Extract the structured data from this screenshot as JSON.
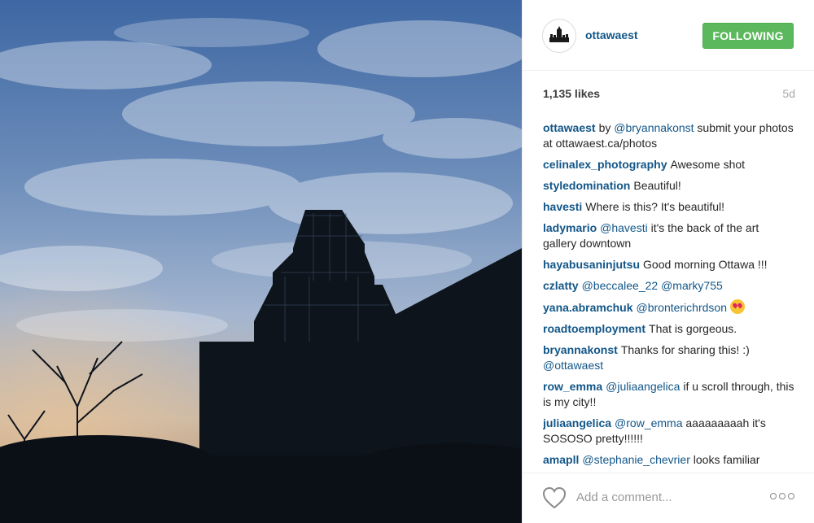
{
  "post": {
    "username": "ottawaest",
    "follow_label": "FOLLOWING",
    "likes": "1,135 likes",
    "age": "5d",
    "comments": [
      {
        "author": "ottawaest",
        "parts": [
          {
            "text": "by "
          },
          {
            "mention": "@bryannakonst"
          },
          {
            "text": " submit your photos at ottawaest.ca/photos"
          }
        ]
      },
      {
        "author": "celinalex_photography",
        "parts": [
          {
            "text": "Awesome shot"
          }
        ]
      },
      {
        "author": "styledomination",
        "parts": [
          {
            "text": "Beautiful!"
          }
        ]
      },
      {
        "author": "havesti",
        "parts": [
          {
            "text": "Where is this? It's beautiful!"
          }
        ]
      },
      {
        "author": "ladymario",
        "parts": [
          {
            "mention": "@havesti"
          },
          {
            "text": " it's the back of the art gallery downtown"
          }
        ]
      },
      {
        "author": "hayabusaninjutsu",
        "parts": [
          {
            "text": "Good morning Ottawa !!!"
          }
        ]
      },
      {
        "author": "czlatty",
        "parts": [
          {
            "mention": "@beccalee_22"
          },
          {
            "text": " "
          },
          {
            "mention": "@marky755"
          }
        ]
      },
      {
        "author": "yana.abramchuk",
        "parts": [
          {
            "mention": "@bronterichrdson"
          },
          {
            "text": " "
          },
          {
            "emoji": "heart-eyes-emoji"
          }
        ]
      },
      {
        "author": "roadtoemployment",
        "parts": [
          {
            "text": "That is gorgeous."
          }
        ]
      },
      {
        "author": "bryannakonst",
        "parts": [
          {
            "text": "Thanks for sharing this! :) "
          },
          {
            "mention": "@ottawaest"
          }
        ]
      },
      {
        "author": "row_emma",
        "parts": [
          {
            "mention": "@juliaangelica"
          },
          {
            "text": " if u scroll through, this is my city!!"
          }
        ]
      },
      {
        "author": "juliaangelica",
        "parts": [
          {
            "mention": "@row_emma"
          },
          {
            "text": " aaaaaaaaah it's SOSOSO pretty!!!!!!"
          }
        ]
      },
      {
        "author": "amapll",
        "parts": [
          {
            "mention": "@stephanie_chevrier"
          },
          {
            "text": " looks familiar"
          }
        ]
      }
    ],
    "comment_placeholder": "Add a comment...",
    "icons": {
      "like": "heart-icon",
      "more": "more-options-icon",
      "avatar": "parliament-logo"
    }
  },
  "colors": {
    "link": "#125688",
    "follow_button": "#5cb85c",
    "muted": "#a5a7aa"
  }
}
